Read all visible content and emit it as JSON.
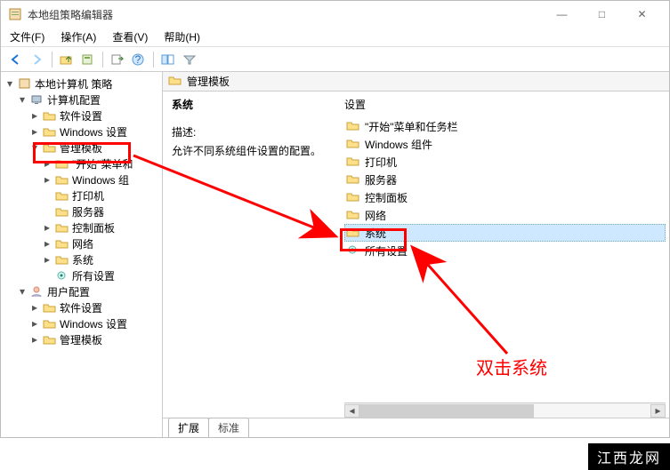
{
  "window": {
    "title": "本地组策略编辑器",
    "sysbuttons": {
      "min": "—",
      "max": "□",
      "close": "✕"
    }
  },
  "menubar": {
    "file": "文件(F)",
    "action": "操作(A)",
    "view": "查看(V)",
    "help": "帮助(H)"
  },
  "toolbar_icons": {
    "back": "back-arrow",
    "forward": "forward-arrow",
    "up": "up-folder",
    "props": "properties",
    "export": "export-list",
    "help": "help",
    "showhide": "show-hide",
    "filter": "filter"
  },
  "tree": {
    "root": {
      "label": "本地计算机 策略"
    },
    "computer": {
      "label": "计算机配置"
    },
    "comp_software": {
      "label": "软件设置"
    },
    "comp_windows": {
      "label": "Windows 设置"
    },
    "comp_admin": {
      "label": "管理模板"
    },
    "at_start": {
      "label": "\"开始\"菜单和"
    },
    "at_wincomp": {
      "label": "Windows 组"
    },
    "at_printers": {
      "label": "打印机"
    },
    "at_servers": {
      "label": "服务器"
    },
    "at_control": {
      "label": "控制面板"
    },
    "at_network": {
      "label": "网络"
    },
    "at_system": {
      "label": "系统"
    },
    "at_all": {
      "label": "所有设置"
    },
    "user": {
      "label": "用户配置"
    },
    "user_software": {
      "label": "软件设置"
    },
    "user_windows": {
      "label": "Windows 设置"
    },
    "user_admin": {
      "label": "管理模板"
    }
  },
  "detail": {
    "path_label": "管理模板",
    "heading": "系统",
    "desc_label": "描述:",
    "desc_text": "允许不同系统组件设置的配置。",
    "settings_header": "设置",
    "items": {
      "start": "\"开始\"菜单和任务栏",
      "wincomp": "Windows 组件",
      "printers": "打印机",
      "servers": "服务器",
      "control": "控制面板",
      "network": "网络",
      "system": "系统",
      "all": "所有设置"
    },
    "tabs": {
      "extended": "扩展",
      "standard": "标准"
    }
  },
  "annotation": {
    "text": "双击系统"
  },
  "watermark": {
    "text": "江西龙网"
  }
}
